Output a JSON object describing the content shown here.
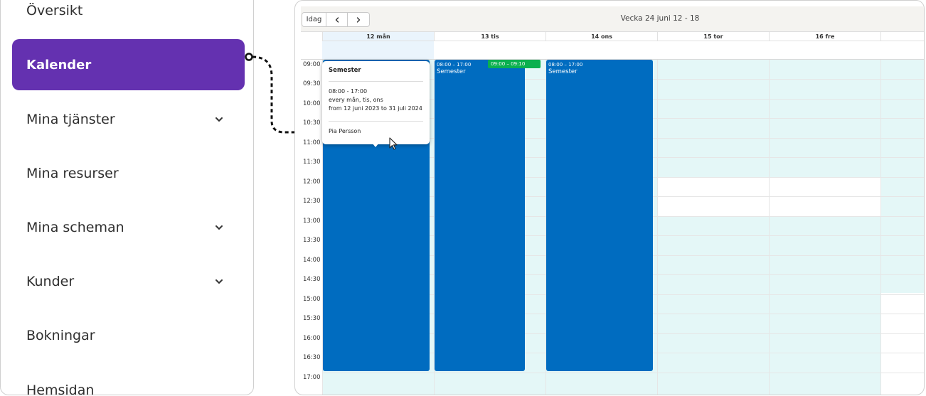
{
  "sidebar": {
    "items": [
      {
        "label": "Översikt",
        "has_children": false
      },
      {
        "label": "Kalender",
        "active": true
      },
      {
        "label": "Mina tjänster",
        "has_children": true
      },
      {
        "label": "Mina resurser",
        "has_children": false
      },
      {
        "label": "Mina scheman",
        "has_children": true
      },
      {
        "label": "Kunder",
        "has_children": true
      },
      {
        "label": "Bokningar",
        "has_children": false
      },
      {
        "label": "Hemsidan",
        "has_children": false
      }
    ]
  },
  "calendar": {
    "today_button": "Idag",
    "prev_icon": "chevron-left-icon",
    "next_icon": "chevron-right-icon",
    "week_title": "Vecka 24 juni 12 - 18",
    "days": [
      "12 mån",
      "13 tis",
      "14 ons",
      "15 tor",
      "16 fre"
    ],
    "times": [
      "09:00",
      "09:30",
      "10:00",
      "10:30",
      "11:00",
      "11:30",
      "12:00",
      "12:30",
      "13:00",
      "13:30",
      "14:00",
      "14:30",
      "15:00",
      "15:30",
      "16:00",
      "16:30",
      "17:00"
    ],
    "events": {
      "tue_time": "08:00 – 17:00",
      "tue_title": "Semester",
      "tue_short": "09:00 – 09:10",
      "wed_time": "08:00 – 17:00",
      "wed_title": "Semester"
    },
    "colors": {
      "event": "#006cc0",
      "short_event": "#0ab04e",
      "available_band": "#e4f7f7",
      "active_nav": "#6431b0"
    }
  },
  "tooltip": {
    "title": "Semester",
    "time": "08:00 - 17:00",
    "recurrence": "every mån, tis, ons",
    "range": "from 12 juni 2023 to 31 juli 2024",
    "person": "Pia Persson"
  }
}
